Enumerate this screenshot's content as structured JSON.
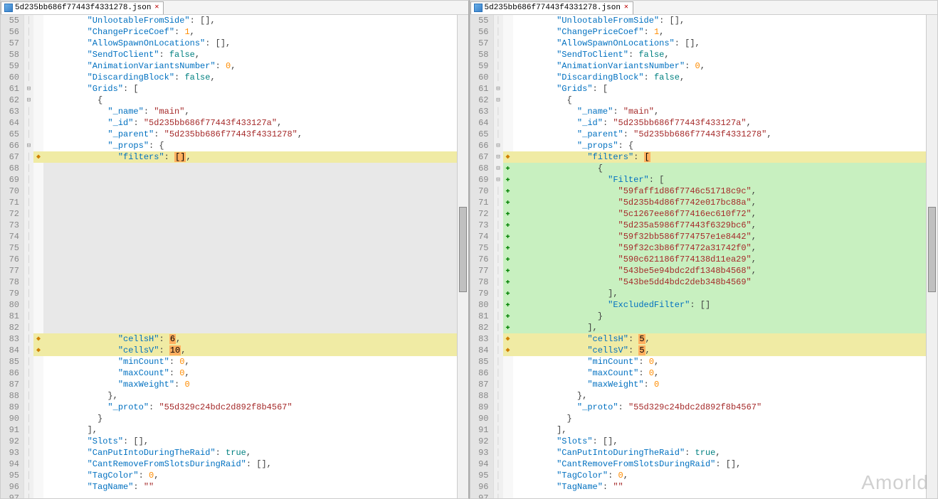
{
  "file_name": "5d235bb686f77443f4331278.json",
  "watermark": "Amorld",
  "left": {
    "lines": [
      {
        "n": 55,
        "f": "l",
        "d": "",
        "hl": "",
        "html": "<span class='key'>\"UnlootableFromSide\"</span><span class='pun'>: [],</span>",
        "indent": 16
      },
      {
        "n": 56,
        "f": "l",
        "d": "",
        "hl": "",
        "html": "<span class='key'>\"ChangePriceCoef\"</span><span class='pun'>: </span><span class='num'>1</span><span class='pun'>,</span>",
        "indent": 16
      },
      {
        "n": 57,
        "f": "l",
        "d": "",
        "hl": "",
        "html": "<span class='key'>\"AllowSpawnOnLocations\"</span><span class='pun'>: [],</span>",
        "indent": 16
      },
      {
        "n": 58,
        "f": "l",
        "d": "",
        "hl": "",
        "html": "<span class='key'>\"SendToClient\"</span><span class='pun'>: </span><span class='bool'>false</span><span class='pun'>,</span>",
        "indent": 16
      },
      {
        "n": 59,
        "f": "l",
        "d": "",
        "hl": "",
        "html": "<span class='key'>\"AnimationVariantsNumber\"</span><span class='pun'>: </span><span class='num'>0</span><span class='pun'>,</span>",
        "indent": 16
      },
      {
        "n": 60,
        "f": "l",
        "d": "",
        "hl": "",
        "html": "<span class='key'>\"DiscardingBlock\"</span><span class='pun'>: </span><span class='bool'>false</span><span class='pun'>,</span>",
        "indent": 16
      },
      {
        "n": 61,
        "f": "o",
        "d": "",
        "hl": "",
        "html": "<span class='key'>\"Grids\"</span><span class='pun'>: [</span>",
        "indent": 16
      },
      {
        "n": 62,
        "f": "o",
        "d": "",
        "hl": "",
        "html": "<span class='pun'>{</span>",
        "indent": 20
      },
      {
        "n": 63,
        "f": "l",
        "d": "",
        "hl": "",
        "html": "<span class='key'>\"_name\"</span><span class='pun'>: </span><span class='str'>\"main\"</span><span class='pun'>,</span>",
        "indent": 24
      },
      {
        "n": 64,
        "f": "l",
        "d": "",
        "hl": "",
        "html": "<span class='key'>\"_id\"</span><span class='pun'>: </span><span class='str'>\"5d235bb686f77443f433127a\"</span><span class='pun'>,</span>",
        "indent": 24
      },
      {
        "n": 65,
        "f": "l",
        "d": "",
        "hl": "",
        "html": "<span class='key'>\"_parent\"</span><span class='pun'>: </span><span class='str'>\"5d235bb686f77443f4331278\"</span><span class='pun'>,</span>",
        "indent": 24
      },
      {
        "n": 66,
        "f": "o",
        "d": "",
        "hl": "",
        "html": "<span class='key'>\"_props\"</span><span class='pun'>: {</span>",
        "indent": 24
      },
      {
        "n": 67,
        "f": "l",
        "d": "y",
        "hl": "yellow",
        "html": "<span class='key'>\"filters\"</span><span class='pun'>: </span><span class='hl-orange'>[]</span><span class='pun'>,</span>",
        "indent": 28
      },
      {
        "n": 68,
        "f": "l",
        "d": "",
        "hl": "gray",
        "html": "",
        "indent": 0
      },
      {
        "n": 69,
        "f": "l",
        "d": "",
        "hl": "gray",
        "html": "",
        "indent": 0
      },
      {
        "n": 70,
        "f": "l",
        "d": "",
        "hl": "gray",
        "html": "",
        "indent": 0
      },
      {
        "n": 71,
        "f": "l",
        "d": "",
        "hl": "gray",
        "html": "",
        "indent": 0
      },
      {
        "n": 72,
        "f": "l",
        "d": "",
        "hl": "gray",
        "html": "",
        "indent": 0
      },
      {
        "n": 73,
        "f": "l",
        "d": "",
        "hl": "gray",
        "html": "",
        "indent": 0
      },
      {
        "n": 74,
        "f": "l",
        "d": "",
        "hl": "gray",
        "html": "",
        "indent": 0
      },
      {
        "n": 75,
        "f": "l",
        "d": "",
        "hl": "gray",
        "html": "",
        "indent": 0
      },
      {
        "n": 76,
        "f": "l",
        "d": "",
        "hl": "gray",
        "html": "",
        "indent": 0
      },
      {
        "n": 77,
        "f": "l",
        "d": "",
        "hl": "gray",
        "html": "",
        "indent": 0
      },
      {
        "n": 78,
        "f": "l",
        "d": "",
        "hl": "gray",
        "html": "",
        "indent": 0
      },
      {
        "n": 79,
        "f": "l",
        "d": "",
        "hl": "gray",
        "html": "",
        "indent": 0
      },
      {
        "n": 80,
        "f": "l",
        "d": "",
        "hl": "gray",
        "html": "",
        "indent": 0
      },
      {
        "n": 81,
        "f": "l",
        "d": "",
        "hl": "gray",
        "html": "",
        "indent": 0
      },
      {
        "n": 82,
        "f": "l",
        "d": "",
        "hl": "gray",
        "html": "",
        "indent": 0
      },
      {
        "n": 83,
        "f": "l",
        "d": "y",
        "hl": "yellow",
        "html": "<span class='key'>\"cellsH\"</span><span class='pun'>: </span><span class='hl-orange'>6</span><span class='pun'>,</span>",
        "indent": 28
      },
      {
        "n": 84,
        "f": "l",
        "d": "y",
        "hl": "yellow",
        "html": "<span class='key'>\"cellsV\"</span><span class='pun'>: </span><span class='hl-orange'>10</span><span class='pun'>,</span>",
        "indent": 28
      },
      {
        "n": 85,
        "f": "l",
        "d": "",
        "hl": "",
        "html": "<span class='key'>\"minCount\"</span><span class='pun'>: </span><span class='num'>0</span><span class='pun'>,</span>",
        "indent": 28
      },
      {
        "n": 86,
        "f": "l",
        "d": "",
        "hl": "",
        "html": "<span class='key'>\"maxCount\"</span><span class='pun'>: </span><span class='num'>0</span><span class='pun'>,</span>",
        "indent": 28
      },
      {
        "n": 87,
        "f": "l",
        "d": "",
        "hl": "",
        "html": "<span class='key'>\"maxWeight\"</span><span class='pun'>: </span><span class='num'>0</span>",
        "indent": 28
      },
      {
        "n": 88,
        "f": "l",
        "d": "",
        "hl": "",
        "html": "<span class='pun'>},</span>",
        "indent": 24
      },
      {
        "n": 89,
        "f": "l",
        "d": "",
        "hl": "",
        "html": "<span class='key'>\"_proto\"</span><span class='pun'>: </span><span class='str'>\"55d329c24bdc2d892f8b4567\"</span>",
        "indent": 24
      },
      {
        "n": 90,
        "f": "l",
        "d": "",
        "hl": "",
        "html": "<span class='pun'>}</span>",
        "indent": 20
      },
      {
        "n": 91,
        "f": "l",
        "d": "",
        "hl": "",
        "html": "<span class='pun'>],</span>",
        "indent": 16
      },
      {
        "n": 92,
        "f": "l",
        "d": "",
        "hl": "",
        "html": "<span class='key'>\"Slots\"</span><span class='pun'>: [],</span>",
        "indent": 16
      },
      {
        "n": 93,
        "f": "l",
        "d": "",
        "hl": "",
        "html": "<span class='key'>\"CanPutIntoDuringTheRaid\"</span><span class='pun'>: </span><span class='bool'>true</span><span class='pun'>,</span>",
        "indent": 16
      },
      {
        "n": 94,
        "f": "l",
        "d": "",
        "hl": "",
        "html": "<span class='key'>\"CantRemoveFromSlotsDuringRaid\"</span><span class='pun'>: [],</span>",
        "indent": 16
      },
      {
        "n": 95,
        "f": "l",
        "d": "",
        "hl": "",
        "html": "<span class='key'>\"TagColor\"</span><span class='pun'>: </span><span class='num'>0</span><span class='pun'>,</span>",
        "indent": 16
      },
      {
        "n": 96,
        "f": "l",
        "d": "",
        "hl": "",
        "html": "<span class='key'>\"TagName\"</span><span class='pun'>: </span><span class='str'>\"\"</span>",
        "indent": 16
      },
      {
        "n": 97,
        "f": "l",
        "d": "",
        "hl": "",
        "html": "",
        "indent": 0
      }
    ]
  },
  "right": {
    "lines": [
      {
        "n": 55,
        "f": "l",
        "d": "",
        "hl": "",
        "html": "<span class='key'>\"UnlootableFromSide\"</span><span class='pun'>: [],</span>",
        "indent": 16
      },
      {
        "n": 56,
        "f": "l",
        "d": "",
        "hl": "",
        "html": "<span class='key'>\"ChangePriceCoef\"</span><span class='pun'>: </span><span class='num'>1</span><span class='pun'>,</span>",
        "indent": 16
      },
      {
        "n": 57,
        "f": "l",
        "d": "",
        "hl": "",
        "html": "<span class='key'>\"AllowSpawnOnLocations\"</span><span class='pun'>: [],</span>",
        "indent": 16
      },
      {
        "n": 58,
        "f": "l",
        "d": "",
        "hl": "",
        "html": "<span class='key'>\"SendToClient\"</span><span class='pun'>: </span><span class='bool'>false</span><span class='pun'>,</span>",
        "indent": 16
      },
      {
        "n": 59,
        "f": "l",
        "d": "",
        "hl": "",
        "html": "<span class='key'>\"AnimationVariantsNumber\"</span><span class='pun'>: </span><span class='num'>0</span><span class='pun'>,</span>",
        "indent": 16
      },
      {
        "n": 60,
        "f": "l",
        "d": "",
        "hl": "",
        "html": "<span class='key'>\"DiscardingBlock\"</span><span class='pun'>: </span><span class='bool'>false</span><span class='pun'>,</span>",
        "indent": 16
      },
      {
        "n": 61,
        "f": "o",
        "d": "",
        "hl": "",
        "html": "<span class='key'>\"Grids\"</span><span class='pun'>: [</span>",
        "indent": 16
      },
      {
        "n": 62,
        "f": "o",
        "d": "",
        "hl": "",
        "html": "<span class='pun'>{</span>",
        "indent": 20
      },
      {
        "n": 63,
        "f": "l",
        "d": "",
        "hl": "",
        "html": "<span class='key'>\"_name\"</span><span class='pun'>: </span><span class='str'>\"main\"</span><span class='pun'>,</span>",
        "indent": 24
      },
      {
        "n": 64,
        "f": "l",
        "d": "",
        "hl": "",
        "html": "<span class='key'>\"_id\"</span><span class='pun'>: </span><span class='str'>\"5d235bb686f77443f433127a\"</span><span class='pun'>,</span>",
        "indent": 24
      },
      {
        "n": 65,
        "f": "l",
        "d": "",
        "hl": "",
        "html": "<span class='key'>\"_parent\"</span><span class='pun'>: </span><span class='str'>\"5d235bb686f77443f4331278\"</span><span class='pun'>,</span>",
        "indent": 24
      },
      {
        "n": 66,
        "f": "o",
        "d": "",
        "hl": "",
        "html": "<span class='key'>\"_props\"</span><span class='pun'>: {</span>",
        "indent": 24
      },
      {
        "n": 67,
        "f": "o",
        "d": "y",
        "hl": "yellow",
        "html": "<span class='key'>\"filters\"</span><span class='pun'>: </span><span class='hl-orange'>[</span>",
        "indent": 28
      },
      {
        "n": 68,
        "f": "o",
        "d": "g",
        "hl": "green",
        "html": "<span class='pun'>{</span>",
        "indent": 32
      },
      {
        "n": 69,
        "f": "o",
        "d": "g",
        "hl": "green",
        "html": "<span class='key'>\"Filter\"</span><span class='pun'>: [</span>",
        "indent": 36
      },
      {
        "n": 70,
        "f": "l",
        "d": "g",
        "hl": "green",
        "html": "<span class='str'>\"59faff1d86f7746c51718c9c\"</span><span class='pun'>,</span>",
        "indent": 40
      },
      {
        "n": 71,
        "f": "l",
        "d": "g",
        "hl": "green",
        "html": "<span class='str'>\"5d235b4d86f7742e017bc88a\"</span><span class='pun'>,</span>",
        "indent": 40
      },
      {
        "n": 72,
        "f": "l",
        "d": "g",
        "hl": "green",
        "html": "<span class='str'>\"5c1267ee86f77416ec610f72\"</span><span class='pun'>,</span>",
        "indent": 40
      },
      {
        "n": 73,
        "f": "l",
        "d": "g",
        "hl": "green",
        "html": "<span class='str'>\"5d235a5986f77443f6329bc6\"</span><span class='pun'>,</span>",
        "indent": 40
      },
      {
        "n": 74,
        "f": "l",
        "d": "g",
        "hl": "green",
        "html": "<span class='str'>\"59f32bb586f774757e1e8442\"</span><span class='pun'>,</span>",
        "indent": 40
      },
      {
        "n": 75,
        "f": "l",
        "d": "g",
        "hl": "green",
        "html": "<span class='str'>\"59f32c3b86f77472a31742f0\"</span><span class='pun'>,</span>",
        "indent": 40
      },
      {
        "n": 76,
        "f": "l",
        "d": "g",
        "hl": "green",
        "html": "<span class='str'>\"590c621186f774138d11ea29\"</span><span class='pun'>,</span>",
        "indent": 40
      },
      {
        "n": 77,
        "f": "l",
        "d": "g",
        "hl": "green",
        "html": "<span class='str'>\"543be5e94bdc2df1348b4568\"</span><span class='pun'>,</span>",
        "indent": 40
      },
      {
        "n": 78,
        "f": "l",
        "d": "g",
        "hl": "green",
        "html": "<span class='str'>\"543be5dd4bdc2deb348b4569\"</span>",
        "indent": 40
      },
      {
        "n": 79,
        "f": "l",
        "d": "g",
        "hl": "green",
        "html": "<span class='pun'>],</span>",
        "indent": 36
      },
      {
        "n": 80,
        "f": "l",
        "d": "g",
        "hl": "green",
        "html": "<span class='key'>\"ExcludedFilter\"</span><span class='pun'>: []</span>",
        "indent": 36
      },
      {
        "n": 81,
        "f": "l",
        "d": "g",
        "hl": "green",
        "html": "<span class='pun'>}</span>",
        "indent": 32
      },
      {
        "n": 82,
        "f": "l",
        "d": "g",
        "hl": "green",
        "html": "<span class='pun'>],</span>",
        "indent": 28
      },
      {
        "n": 83,
        "f": "l",
        "d": "y",
        "hl": "yellow",
        "html": "<span class='key'>\"cellsH\"</span><span class='pun'>: </span><span class='hl-orange'>5</span><span class='pun'>,</span>",
        "indent": 28
      },
      {
        "n": 84,
        "f": "l",
        "d": "y",
        "hl": "yellow",
        "html": "<span class='key'>\"cellsV\"</span><span class='pun'>: </span><span class='hl-orange'>5</span><span class='pun'>,</span>",
        "indent": 28
      },
      {
        "n": 85,
        "f": "l",
        "d": "",
        "hl": "",
        "html": "<span class='key'>\"minCount\"</span><span class='pun'>: </span><span class='num'>0</span><span class='pun'>,</span>",
        "indent": 28
      },
      {
        "n": 86,
        "f": "l",
        "d": "",
        "hl": "",
        "html": "<span class='key'>\"maxCount\"</span><span class='pun'>: </span><span class='num'>0</span><span class='pun'>,</span>",
        "indent": 28
      },
      {
        "n": 87,
        "f": "l",
        "d": "",
        "hl": "",
        "html": "<span class='key'>\"maxWeight\"</span><span class='pun'>: </span><span class='num'>0</span>",
        "indent": 28
      },
      {
        "n": 88,
        "f": "l",
        "d": "",
        "hl": "",
        "html": "<span class='pun'>},</span>",
        "indent": 24
      },
      {
        "n": 89,
        "f": "l",
        "d": "",
        "hl": "",
        "html": "<span class='key'>\"_proto\"</span><span class='pun'>: </span><span class='str'>\"55d329c24bdc2d892f8b4567\"</span>",
        "indent": 24
      },
      {
        "n": 90,
        "f": "l",
        "d": "",
        "hl": "",
        "html": "<span class='pun'>}</span>",
        "indent": 20
      },
      {
        "n": 91,
        "f": "l",
        "d": "",
        "hl": "",
        "html": "<span class='pun'>],</span>",
        "indent": 16
      },
      {
        "n": 92,
        "f": "l",
        "d": "",
        "hl": "",
        "html": "<span class='key'>\"Slots\"</span><span class='pun'>: [],</span>",
        "indent": 16
      },
      {
        "n": 93,
        "f": "l",
        "d": "",
        "hl": "",
        "html": "<span class='key'>\"CanPutIntoDuringTheRaid\"</span><span class='pun'>: </span><span class='bool'>true</span><span class='pun'>,</span>",
        "indent": 16
      },
      {
        "n": 94,
        "f": "l",
        "d": "",
        "hl": "",
        "html": "<span class='key'>\"CantRemoveFromSlotsDuringRaid\"</span><span class='pun'>: [],</span>",
        "indent": 16
      },
      {
        "n": 95,
        "f": "l",
        "d": "",
        "hl": "",
        "html": "<span class='key'>\"TagColor\"</span><span class='pun'>: </span><span class='num'>0</span><span class='pun'>,</span>",
        "indent": 16
      },
      {
        "n": 96,
        "f": "l",
        "d": "",
        "hl": "",
        "html": "<span class='key'>\"TagName\"</span><span class='pun'>: </span><span class='str'>\"\"</span>",
        "indent": 16
      },
      {
        "n": 97,
        "f": "l",
        "d": "",
        "hl": "",
        "html": "",
        "indent": 0
      }
    ]
  }
}
